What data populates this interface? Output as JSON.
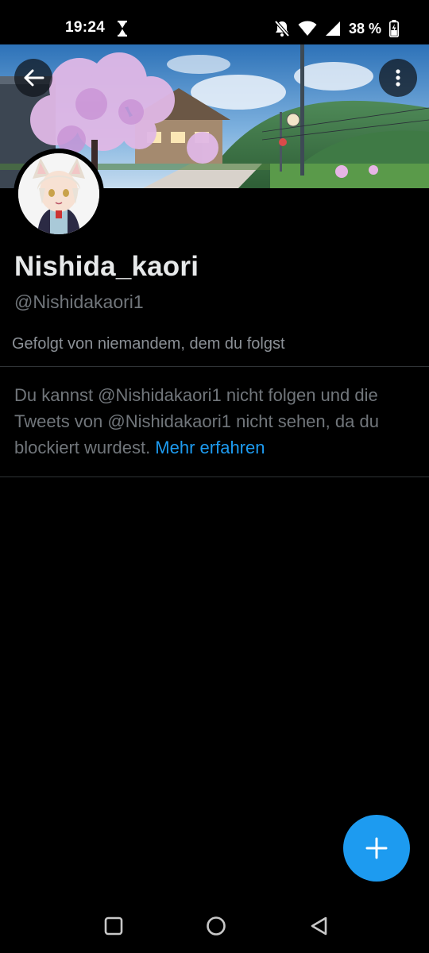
{
  "status_bar": {
    "time": "19:24",
    "battery": "38 %"
  },
  "header": {
    "back_icon": "arrow-left-icon",
    "more_icon": "more-vertical-icon"
  },
  "profile": {
    "display_name": "Nishida_kaori",
    "handle": "@Nishidakaori1",
    "followed_by": "Gefolgt von niemandem, dem du folgst",
    "blocked_message": "Du kannst @Nishidakaori1 nicht folgen und die Tweets von @Nishidakaori1 nicht sehen, da du blockiert wurdest. ",
    "learn_more": "Mehr erfahren"
  },
  "fab": {
    "icon": "plus-icon"
  },
  "nav": {
    "recents_icon": "square-icon",
    "home_icon": "circle-icon",
    "back_icon": "triangle-back-icon"
  },
  "colors": {
    "background": "#000000",
    "text_primary": "#e7e9ea",
    "text_secondary": "#71767b",
    "accent": "#1d9bf0",
    "divider": "#2f3336"
  }
}
